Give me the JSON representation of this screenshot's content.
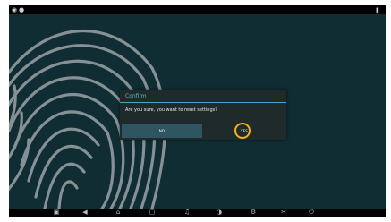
{
  "dialog": {
    "title": "Confirm",
    "message": "Are you sure, you want to reset settings?",
    "no_label": "NO",
    "yes_label": "YES"
  },
  "statusbar": {
    "left_icons": [
      "notification-icon",
      "dot-icon"
    ],
    "right_icons": [
      "battery-icon"
    ]
  },
  "navbar": {
    "icons": [
      "screenshot-icon",
      "back-icon",
      "home-icon",
      "recent-apps-icon",
      "volume-icon",
      "display-icon",
      "settings-icon",
      "scissors-icon",
      "power-icon"
    ]
  },
  "colors": {
    "screen_background": "#0f2d32",
    "fingerprint": "#9aa3a6",
    "dialog_background": "#1f2a2b",
    "dialog_title": "#5fb2cf",
    "no_button": "#2f5462",
    "highlight": "#f0b020"
  }
}
